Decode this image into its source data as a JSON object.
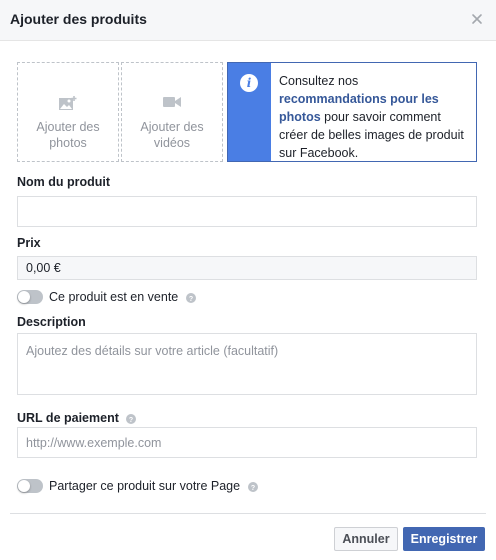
{
  "dialog": {
    "title": "Ajouter des produits"
  },
  "media": {
    "photos_label": "Ajouter des photos",
    "videos_label": "Ajouter des vidéos"
  },
  "info_box": {
    "text_before": "Consultez nos ",
    "link_text": "recommandations pour les photos",
    "text_after": " pour savoir comment créer de belles images de produit sur Facebook."
  },
  "form": {
    "name_label": "Nom du produit",
    "name_value": "",
    "price_label": "Prix",
    "price_value": "0,00 €",
    "on_sale_label": "Ce produit est en vente",
    "on_sale_enabled": false,
    "description_label": "Description",
    "description_placeholder": "Ajoutez des détails sur votre article (facultatif)",
    "payment_url_label": "URL de paiement",
    "payment_url_placeholder": "http://www.exemple.com",
    "share_label": "Partager ce produit sur votre Page",
    "share_enabled": false
  },
  "footer": {
    "cancel_label": "Annuler",
    "save_label": "Enregistrer"
  },
  "colors": {
    "accent": "#4267b2",
    "info_bar": "#4a7ee4",
    "link": "#365899"
  }
}
